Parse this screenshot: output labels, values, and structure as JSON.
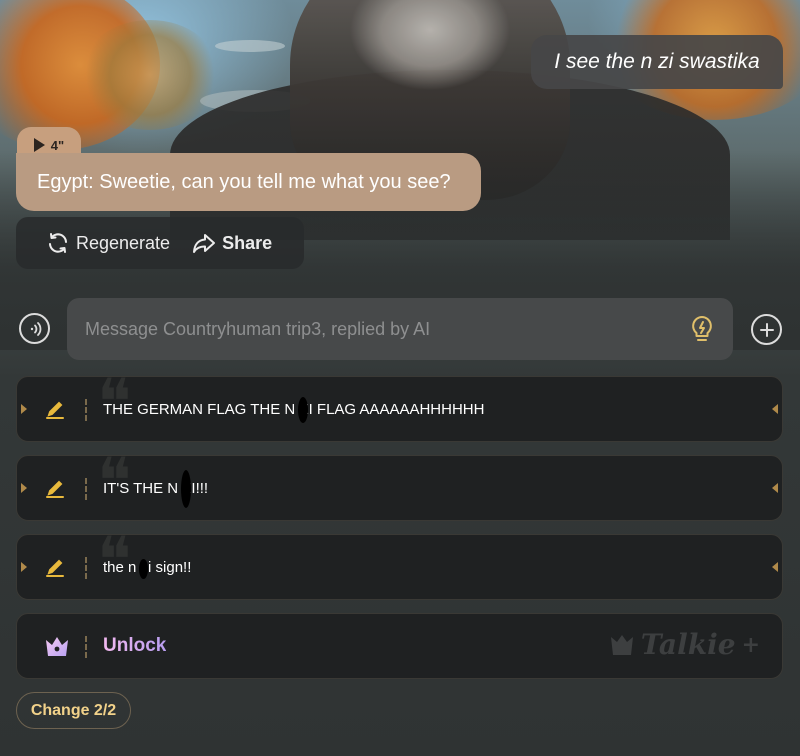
{
  "chat": {
    "user_message": "I see the n zi swastika",
    "voice_duration": "4\"",
    "ai_message": "Egypt: Sweetie, can you tell me what you see?",
    "regenerate_label": "Regenerate",
    "share_label": "Share"
  },
  "input": {
    "placeholder": "Message Countryhuman trip3, replied by AI"
  },
  "suggestions": [
    {
      "text": "THE GERMAN FLAG THE N  ZI FLAG AAAAAAHHHHHH"
    },
    {
      "text": "IT'S THE N  ZI!!!"
    },
    {
      "text": "the n  zi sign!!"
    }
  ],
  "unlock": {
    "label": "Unlock",
    "watermark": "Talkie"
  },
  "change": {
    "label": "Change 2/2"
  },
  "colors": {
    "ai_bubble": "#b99b82",
    "accent_gold": "#f2d28a",
    "unlock_gradient_start": "#f2b9f0",
    "unlock_gradient_end": "#b99ef0"
  },
  "icons": [
    "play-icon",
    "regenerate-icon",
    "share-icon",
    "voice-wave-icon",
    "lightbulb-icon",
    "plus-icon",
    "pencil-icon",
    "crown-icon",
    "talkie-logo-icon"
  ]
}
